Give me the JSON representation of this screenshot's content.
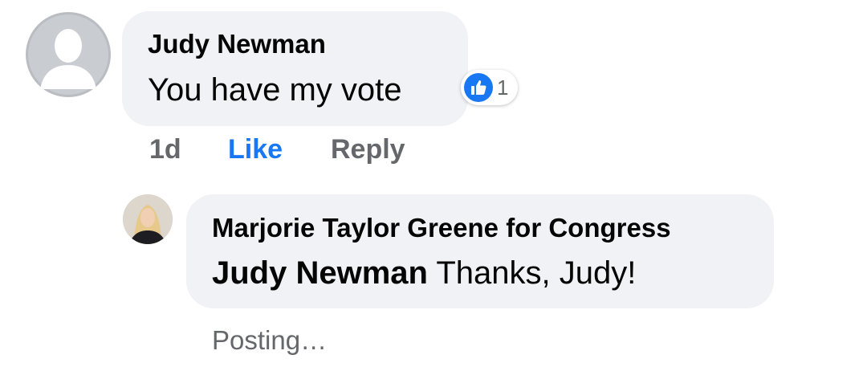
{
  "comment": {
    "author": "Judy Newman",
    "text": "You have my vote",
    "reaction": {
      "icon": "thumbs-up-icon",
      "count": "1",
      "color": "#1877f2"
    },
    "actions": {
      "time": "1d",
      "like": "Like",
      "reply": "Reply"
    }
  },
  "reply": {
    "author": "Marjorie Taylor Greene for Congress",
    "mention": "Judy Newman",
    "text": "Thanks, Judy!",
    "status": "Posting…"
  },
  "colors": {
    "bubble": "#f0f2f5",
    "text": "#050505",
    "muted": "#65676b",
    "link": "#1877f2"
  }
}
